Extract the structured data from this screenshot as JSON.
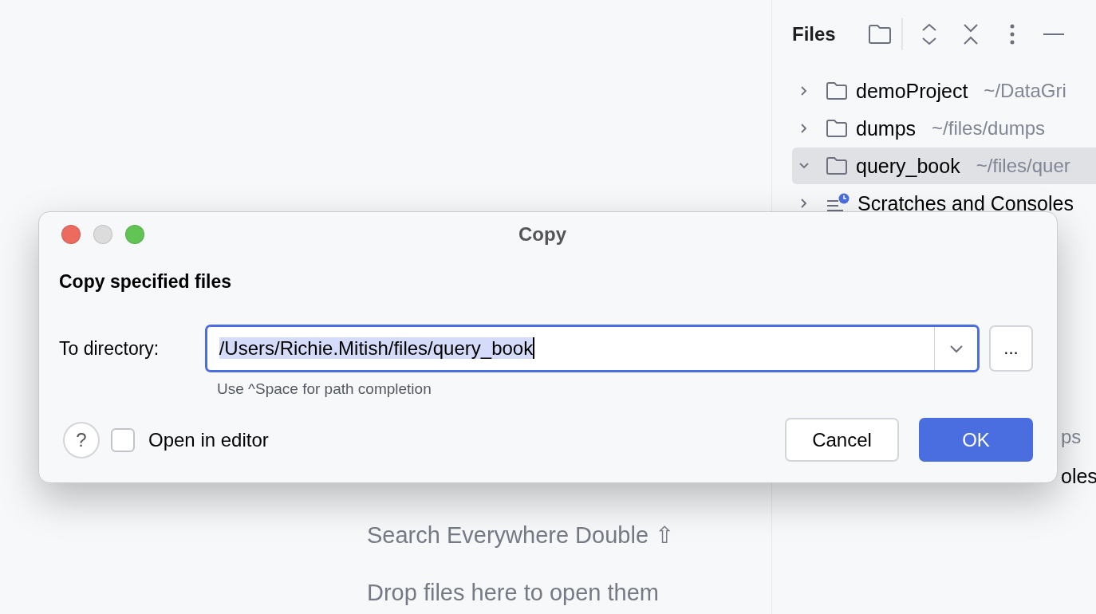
{
  "editor": {
    "hints": [
      "Search Everywhere Double ⇧",
      "Drop files here to open them"
    ]
  },
  "files_panel": {
    "title": "Files",
    "tree": [
      {
        "kind": "folder",
        "name": "demoProject",
        "path": "~/DataGri",
        "expanded": false,
        "selected": false
      },
      {
        "kind": "folder",
        "name": "dumps",
        "path": "~/files/dumps",
        "expanded": false,
        "selected": false
      },
      {
        "kind": "folder",
        "name": "query_book",
        "path": "~/files/quer",
        "expanded": true,
        "selected": true
      },
      {
        "kind": "scratches",
        "name": "Scratches and Consoles",
        "expanded": false,
        "selected": false
      }
    ],
    "partial_rows": [
      {
        "kind": "path",
        "text": "ps"
      },
      {
        "kind": "name",
        "text": "oles"
      }
    ]
  },
  "dialog": {
    "title": "Copy",
    "heading": "Copy specified files",
    "directory_label": "To directory:",
    "directory_value": "/Users/Richie.Mitish/files/query_book",
    "value_selected": true,
    "browse_label": "...",
    "hint": "Use ^Space for path completion",
    "help_label": "?",
    "open_in_editor": {
      "label": "Open in editor",
      "checked": false
    },
    "buttons": [
      {
        "label": "Cancel",
        "primary": false
      },
      {
        "label": "OK",
        "primary": true
      }
    ]
  }
}
